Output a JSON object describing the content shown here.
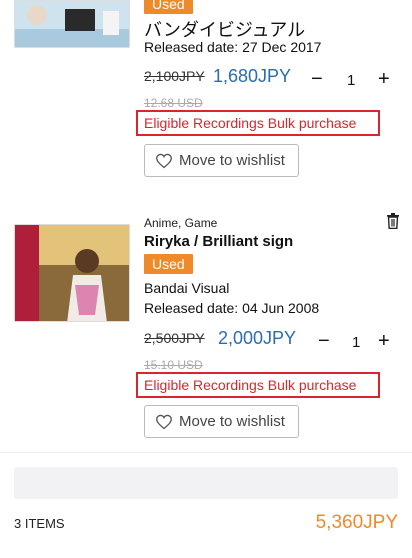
{
  "items": [
    {
      "badge": "Used",
      "title": "バンダイビジュアル",
      "released": "Released date: 27 Dec 2017",
      "old_price": "2,100JPY",
      "price": "1,680JPY",
      "usd": "12.68 USD",
      "qty": "1",
      "bulk": "Eligible Recordings Bulk purchase",
      "wishlist": "Move to wishlist"
    },
    {
      "genre": "Anime, Game",
      "title": "Riryka / Brilliant sign",
      "badge": "Used",
      "label": "Bandai Visual",
      "released": "Released date: 04 Jun 2008",
      "old_price": "2,500JPY",
      "price": "2,000JPY",
      "usd": "15.10 USD",
      "qty": "1",
      "bulk": "Eligible Recordings Bulk purchase",
      "wishlist": "Move to wishlist"
    }
  ],
  "qty_controls": {
    "minus": "−",
    "plus": "+"
  },
  "footer": {
    "count": "3  ITEMS",
    "total": "5,360JPY"
  },
  "colors": {
    "accent": "#ef8a2b",
    "price_blue": "#2b6cb0",
    "highlight_red": "#d8262e"
  }
}
